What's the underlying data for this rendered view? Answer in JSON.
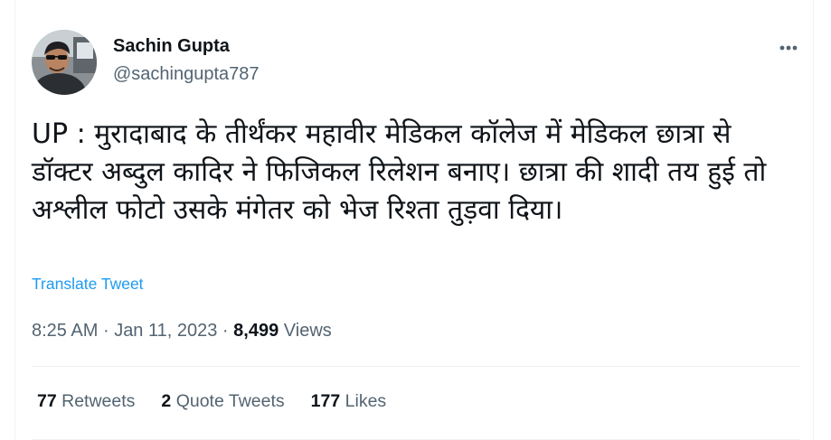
{
  "author": {
    "display_name": "Sachin Gupta",
    "handle": "@sachingupta787",
    "avatar_icon": "avatar-photo"
  },
  "more_options_icon": "more-horizontal-icon",
  "tweet": {
    "text": "UP : मुरादाबाद के तीर्थंकर महावीर मेडिकल कॉलेज में मेडिकल छात्रा से डॉक्टर अब्दुल कादिर ने फिजिकल रिलेशन बनाए। छात्रा की शादी तय हुई तो अश्लील फोटो उसके मंगेतर को भेज रिश्ता तुड़वा दिया।",
    "translate_label": "Translate Tweet"
  },
  "meta": {
    "time": "8:25 AM",
    "date": "Jan 11, 2023",
    "separator": "·",
    "views_count": "8,499",
    "views_label": "Views"
  },
  "stats": {
    "retweets_count": "77",
    "retweets_label": "Retweets",
    "quotes_count": "2",
    "quotes_label": "Quote Tweets",
    "likes_count": "177",
    "likes_label": "Likes"
  },
  "colors": {
    "link": "#1d9bf0",
    "secondary_text": "#536471",
    "primary_text": "#0f1419",
    "divider": "#eff3f4"
  }
}
